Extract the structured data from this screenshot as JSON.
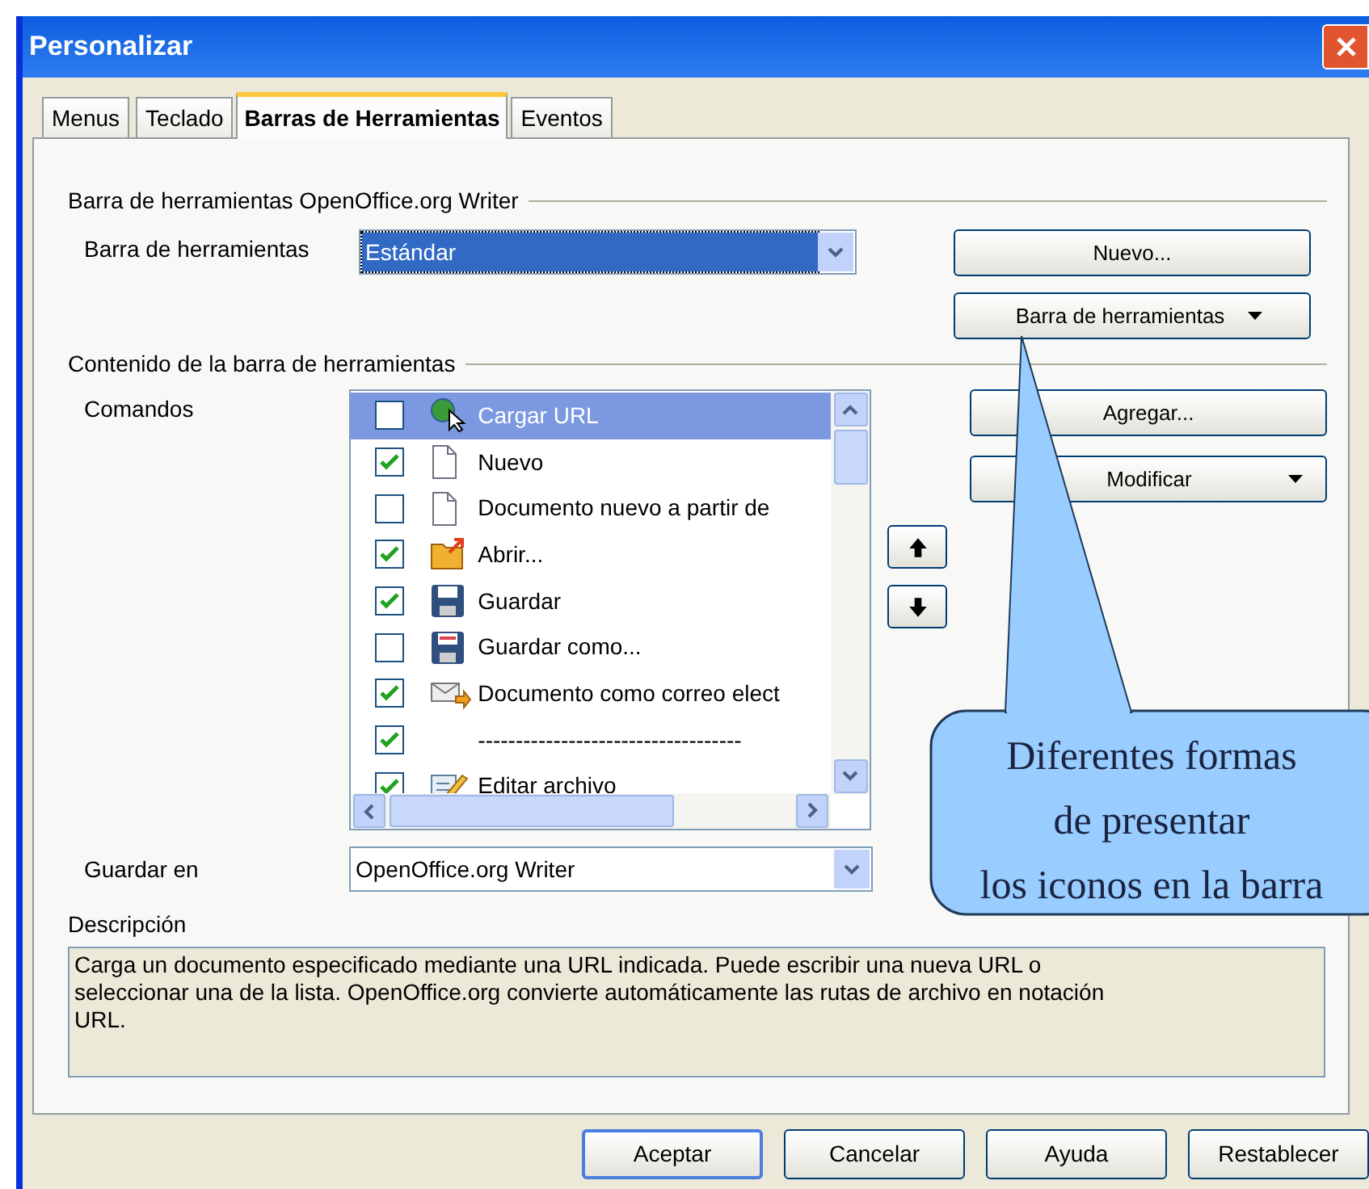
{
  "window": {
    "title": "Personalizar"
  },
  "tabs": [
    {
      "label": "Menus",
      "selected": false
    },
    {
      "label": "Teclado",
      "selected": false
    },
    {
      "label": "Barras de Herramientas",
      "selected": true
    },
    {
      "label": "Eventos",
      "selected": false
    }
  ],
  "toolbar_section": {
    "heading": "Barra de herramientas OpenOffice.org Writer",
    "label": "Barra de herramientas",
    "value": "Estándar",
    "buttons": [
      "Nuevo...",
      "Barra de herramientas"
    ]
  },
  "content_section": {
    "heading": "Contenido de la barra de herramientas",
    "label": "Comandos",
    "commands": [
      {
        "label": "Cargar URL",
        "kind": "globe",
        "checked": false,
        "selected": true
      },
      {
        "label": "Nuevo",
        "kind": "document",
        "checked": true,
        "selected": false
      },
      {
        "label": "Documento nuevo a partir de",
        "kind": "document",
        "checked": false,
        "selected": false
      },
      {
        "label": "Abrir...",
        "kind": "folder",
        "checked": true,
        "selected": false
      },
      {
        "label": "Guardar",
        "kind": "save",
        "checked": true,
        "selected": false
      },
      {
        "label": "Guardar como...",
        "kind": "saveas",
        "checked": false,
        "selected": false
      },
      {
        "label": "Documento como correo elect",
        "kind": "mail",
        "checked": true,
        "selected": false
      },
      {
        "label": "-----------------------------------",
        "kind": "separator",
        "checked": true,
        "selected": false
      },
      {
        "label": "Editar archivo",
        "kind": "edit",
        "checked": true,
        "selected": false
      }
    ],
    "buttons": [
      "Agregar...",
      "Modificar"
    ],
    "save_in_label": "Guardar en",
    "save_in_value": "OpenOffice.org Writer"
  },
  "description": {
    "label": "Descripción",
    "text": "Carga un documento especificado mediante una URL indicada. Puede escribir una nueva URL o seleccionar una de la lista. OpenOffice.org convierte automáticamente las rutas de archivo en notación URL."
  },
  "buttons": [
    "Aceptar",
    "Cancelar",
    "Ayuda",
    "Restablecer"
  ],
  "callout": {
    "lines": [
      "Diferentes formas",
      "de presentar",
      "los iconos en la barra"
    ]
  }
}
